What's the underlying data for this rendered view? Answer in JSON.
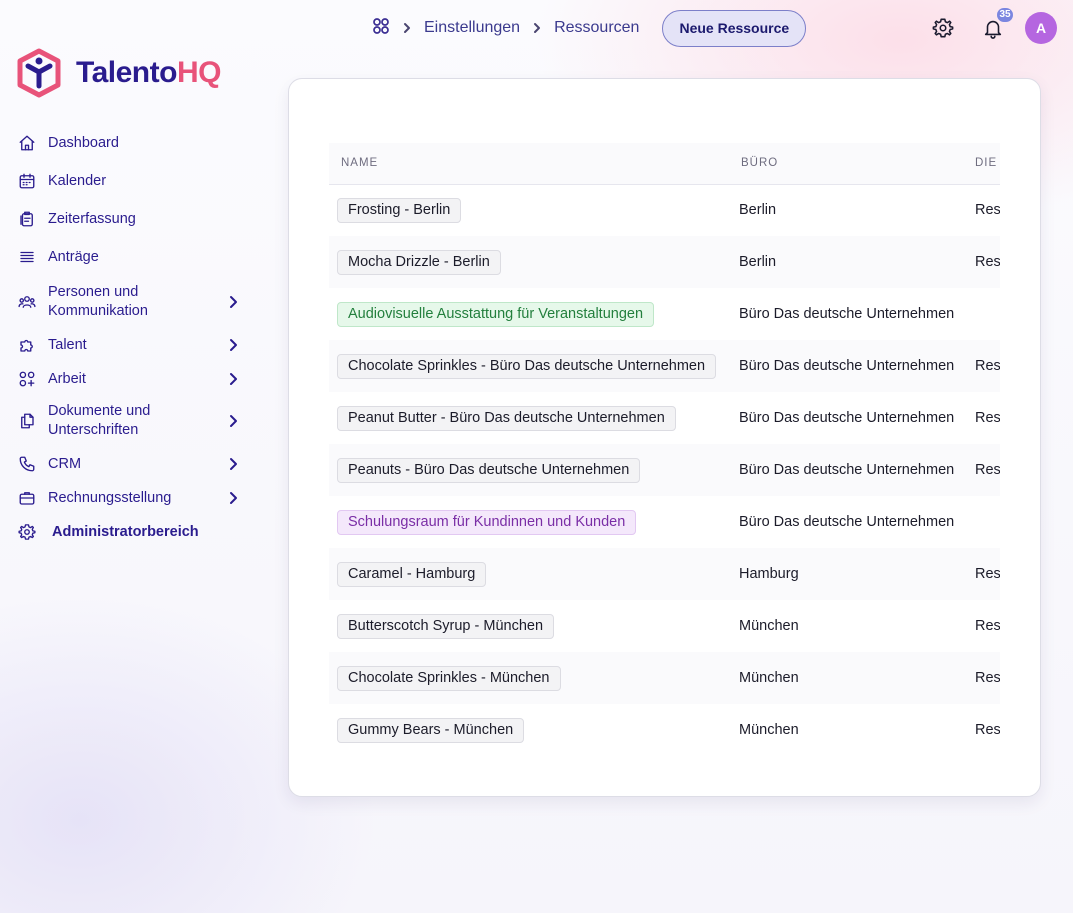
{
  "brand": {
    "name_part1": "Talento",
    "name_part2": "HQ"
  },
  "sidebar": {
    "items": [
      {
        "label": "Dashboard",
        "icon": "home-icon",
        "has_chevron": false
      },
      {
        "label": "Kalender",
        "icon": "calendar-icon",
        "has_chevron": false
      },
      {
        "label": "Zeiterfassung",
        "icon": "clipboard-icon",
        "has_chevron": false
      },
      {
        "label": "Anträge",
        "icon": "list-icon",
        "has_chevron": false
      },
      {
        "label_line1": "Personen und",
        "label_line2": "Kommunikation",
        "icon": "people-icon",
        "has_chevron": true
      },
      {
        "label": "Talent",
        "icon": "puzzle-icon",
        "has_chevron": true
      },
      {
        "label": "Arbeit",
        "icon": "grid-plus-icon",
        "has_chevron": true
      },
      {
        "label_line1": "Dokumente und",
        "label_line2": "Unterschriften",
        "icon": "documents-icon",
        "has_chevron": true
      },
      {
        "label": "CRM",
        "icon": "phone-icon",
        "has_chevron": true
      },
      {
        "label": "Rechnungsstellung",
        "icon": "briefcase-icon",
        "has_chevron": true
      },
      {
        "label": "Administratorbereich",
        "icon": "gear-icon",
        "has_chevron": false,
        "active": true
      }
    ]
  },
  "breadcrumb": {
    "home_icon": "apps-grid-icon",
    "items": [
      "Einstellungen",
      "Ressourcen"
    ]
  },
  "new_button_label": "Neue Ressource",
  "header_icons": {
    "settings": "gear-icon",
    "notifications": "bell-icon",
    "notification_count": "35",
    "avatar_initial": "A"
  },
  "table": {
    "columns": [
      "NAME",
      "BÜRO",
      "DIE"
    ],
    "rows": [
      {
        "name": "Frosting - Berlin",
        "tag": "default",
        "office": "Berlin",
        "third": "Ress"
      },
      {
        "name": "Mocha Drizzle - Berlin",
        "tag": "default",
        "office": "Berlin",
        "third": "Ress"
      },
      {
        "name": "Audiovisuelle Ausstattung für Veranstaltungen",
        "tag": "green",
        "office": "Büro Das deutsche Unternehmen",
        "third": ""
      },
      {
        "name": "Chocolate Sprinkles - Büro Das deutsche Unternehmen",
        "tag": "default",
        "office": "Büro Das deutsche Unternehmen",
        "third": "Ress"
      },
      {
        "name": "Peanut Butter - Büro Das deutsche Unternehmen",
        "tag": "default",
        "office": "Büro Das deutsche Unternehmen",
        "third": "Ress"
      },
      {
        "name": "Peanuts - Büro Das deutsche Unternehmen",
        "tag": "default",
        "office": "Büro Das deutsche Unternehmen",
        "third": "Ress"
      },
      {
        "name": "Schulungsraum für Kundinnen und Kunden",
        "tag": "purple",
        "office": "Büro Das deutsche Unternehmen",
        "third": ""
      },
      {
        "name": "Caramel - Hamburg",
        "tag": "default",
        "office": "Hamburg",
        "third": "Ress"
      },
      {
        "name": "Butterscotch Syrup - München",
        "tag": "default",
        "office": "München",
        "third": "Ress"
      },
      {
        "name": "Chocolate Sprinkles - München",
        "tag": "default",
        "office": "München",
        "third": "Ress"
      },
      {
        "name": "Gummy Bears - München",
        "tag": "default",
        "office": "München",
        "third": "Ress"
      }
    ]
  },
  "colors": {
    "brand_primary": "#2a1c8e",
    "brand_accent": "#e8537a",
    "avatar": "#b566e0",
    "badge": "#7b86e0",
    "button_bg": "#e4e3f7"
  }
}
